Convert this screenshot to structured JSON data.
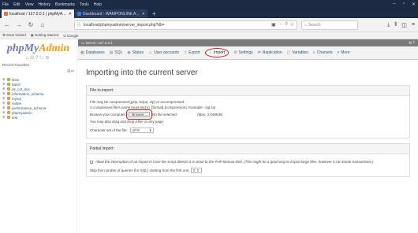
{
  "browser": {
    "menus": [
      "File",
      "Edit",
      "View",
      "History",
      "Bookmarks",
      "Tools",
      "Help"
    ],
    "tabs": [
      {
        "label": "localhost / 127.0.0.1 | phpMyA..."
      },
      {
        "label": "Dashboard - WAMPONLINE A..."
      }
    ],
    "url": "localhost/phpmyadmin/server_import.php?db=",
    "search_placeholder": "Search",
    "bookmarks": [
      "Most Visited",
      "Getting Started",
      "Google"
    ]
  },
  "sidebar": {
    "logo_main": "phpMy",
    "logo_accent": "Admin",
    "recent_label": "Recent   Favorites",
    "databases": [
      "New",
      "batch",
      "ds_cst_dus",
      "information_schema",
      "mysql",
      "online",
      "performance_schema",
      "phpmyadmin",
      "test"
    ]
  },
  "server_bar": {
    "label": "Server: 127.0.0.1"
  },
  "top_menu": [
    {
      "icon": "▦",
      "label": "Databases"
    },
    {
      "icon": "▤",
      "label": "SQL"
    },
    {
      "icon": "◉",
      "label": "Status"
    },
    {
      "icon": "☺",
      "label": "User accounts"
    },
    {
      "icon": "⇪",
      "label": "Export"
    },
    {
      "icon": "⇩",
      "label": "Import",
      "active": true
    },
    {
      "icon": "⚙",
      "label": "Settings"
    },
    {
      "icon": "⇄",
      "label": "Replication"
    },
    {
      "icon": "▢",
      "label": "Variables"
    },
    {
      "icon": "≡",
      "label": "Charsets"
    },
    {
      "icon": "▾",
      "label": "More"
    }
  ],
  "page": {
    "title": "Importing into the current server",
    "file_section": {
      "legend": "File to import:",
      "line1": "File may be compressed (gzip, bzip2, zip) or uncompressed.",
      "line2": "A compressed file's name must end in .[format].[compression]. Example: .sql.zip",
      "browse_label": "Browse your computer:",
      "browse_button": "Browse...",
      "no_file": "No file selected.",
      "max_size": "(Max: 2,048KiB)",
      "drag_hint": "You may also drag and drop a file on any page.",
      "charset_label": "Character set of the file:",
      "charset_value": "utf-8"
    },
    "partial_section": {
      "legend": "Partial import:",
      "allow_text": "Allow the interruption of an import in case the script detects it is close to the PHP timeout limit. (This might be a good way to import large files, however it can break transactions.)",
      "skip_label": "Skip this number of queries (for SQL) starting from the first one:",
      "skip_value": "0"
    }
  }
}
